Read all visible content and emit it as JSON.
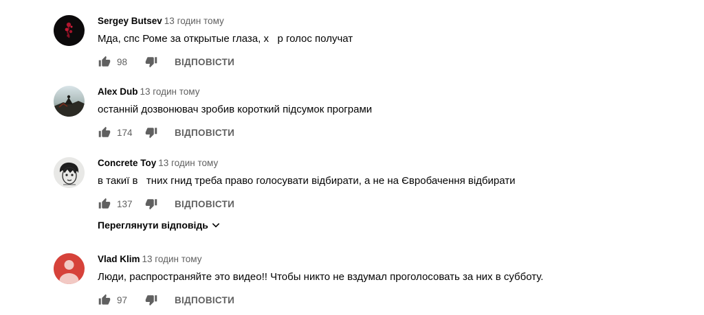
{
  "comments": [
    {
      "author": "Sergey Butsev",
      "time": "13 годин тому",
      "text": "Мда, спс Роме за открытые глаза, х   р голос получат",
      "likes": "98",
      "reply_label": "ВІДПОВІСТИ",
      "avatar": "dark-rose-avatar"
    },
    {
      "author": "Alex Dub",
      "time": "13 годин тому",
      "text": "останній дозвонювач зробив короткий підсумок програми",
      "likes": "174",
      "reply_label": "ВІДПОВІСТИ",
      "avatar": "landscape-figure-avatar"
    },
    {
      "author": "Concrete Toy",
      "time": "13 годин тому",
      "text": "в такиї в   тних гнид треба право голосувати відбирати, а не на Євробачення відбирати",
      "likes": "137",
      "reply_label": "ВІДПОВІСТИ",
      "avatar": "sketch-face-avatar"
    },
    {
      "author": "Vlad Klim",
      "time": "13 годин тому",
      "text": "Люди, распространяйте это видео!! Чтобы никто не вздумал проголосовать за них в субботу.",
      "likes": "97",
      "reply_label": "ВІДПОВІСТИ",
      "avatar": "default-user-avatar"
    }
  ],
  "view_replies_label": "Переглянути відповідь",
  "colors": {
    "secondary_text": "#606060",
    "primary_text": "#030303",
    "default_avatar_bg": "#d6423a"
  },
  "icons": {
    "like": "thumbs-up-icon",
    "dislike": "thumbs-down-icon",
    "expand": "chevron-down-icon"
  }
}
